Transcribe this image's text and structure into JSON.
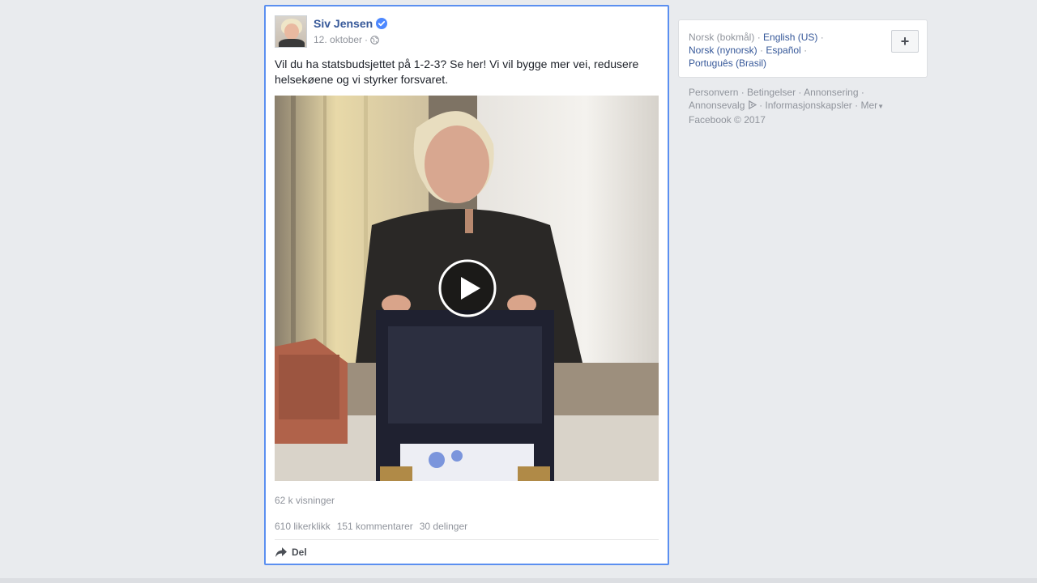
{
  "post": {
    "author": "Siv Jensen",
    "date": "12. oktober",
    "separator": "·",
    "text": "Vil du ha statsbudsjettet på 1-2-3? Se her! Vi vil bygge mer vei, redusere helsekøene og vi styrker forsvaret.",
    "views": "62 k visninger",
    "likes": "610 likerklikk",
    "comments": "151 kommentarer",
    "shares": "30 delinger",
    "share_label": "Del"
  },
  "languages": {
    "current": "Norsk (bokmål)",
    "english": "English (US)",
    "nynorsk": "Norsk (nynorsk)",
    "spanish": "Español",
    "portuguese": "Português (Brasil)",
    "add_label": "+"
  },
  "footer": {
    "privacy": "Personvern",
    "terms": "Betingelser",
    "advertising": "Annonsering",
    "adchoices": "Annonsevalg",
    "cookies": "Informasjonskapsler",
    "more": "Mer",
    "copyright": "Facebook © 2017"
  },
  "colors": {
    "link": "#365899",
    "muted": "#90949c",
    "focus_border": "#5b8ff0",
    "background": "#e9ebee"
  }
}
